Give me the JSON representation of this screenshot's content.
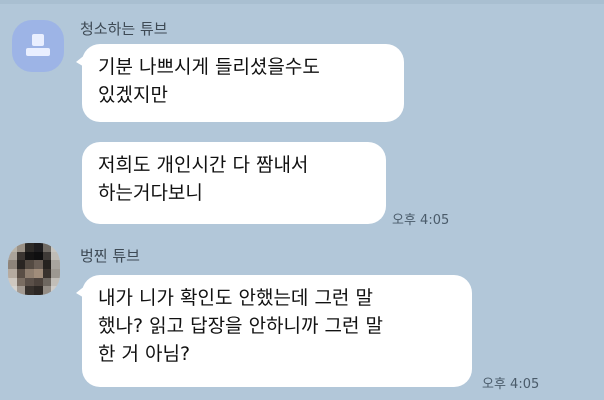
{
  "chat": {
    "messages": [
      {
        "sender": "청소하는 튜브",
        "lines": [
          "기분 나쁘시게 들리셨을수도",
          "있겠지만"
        ]
      },
      {
        "sender": "청소하는 튜브",
        "lines": [
          "저희도 개인시간 다 짬내서",
          "하는거다보니"
        ],
        "time": "오후 4:05"
      },
      {
        "sender": "벙찐 튜브",
        "lines": [
          "내가 니가 확인도 안했는데 그런 말",
          "했나? 읽고 답장을 안하니까 그런 말",
          "한 거 아님?"
        ],
        "time": "오후 4:05"
      }
    ]
  },
  "colors": {
    "background": "#b2c7d9",
    "bubble": "#ffffff",
    "default_avatar": "#9db4e6"
  },
  "icons": {
    "default_avatar": "default-profile-icon",
    "pixel_avatar": "pixelated-profile-photo"
  }
}
